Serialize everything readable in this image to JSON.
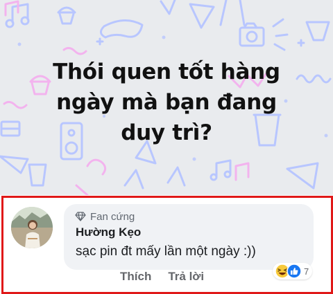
{
  "post": {
    "lines": [
      "Thói quen tốt hàng",
      "ngày mà bạn đang",
      "duy trì?"
    ]
  },
  "comment": {
    "badge_icon": "diamond-icon",
    "badge_label": "Fan cứng",
    "author": "Hường Kẹo",
    "text": "sạc pin đt mấy lần một ngày :))",
    "reactions": [
      "haha-reaction-icon",
      "like-reaction-icon"
    ],
    "reaction_count": "7",
    "actions": {
      "like": "Thích",
      "reply": "Trả lời"
    }
  },
  "colors": {
    "highlight_border": "#e01818",
    "doodle_blue": "#b8c6ff",
    "doodle_pink": "#f3b3ee",
    "bubble_bg": "#f0f2f5"
  }
}
